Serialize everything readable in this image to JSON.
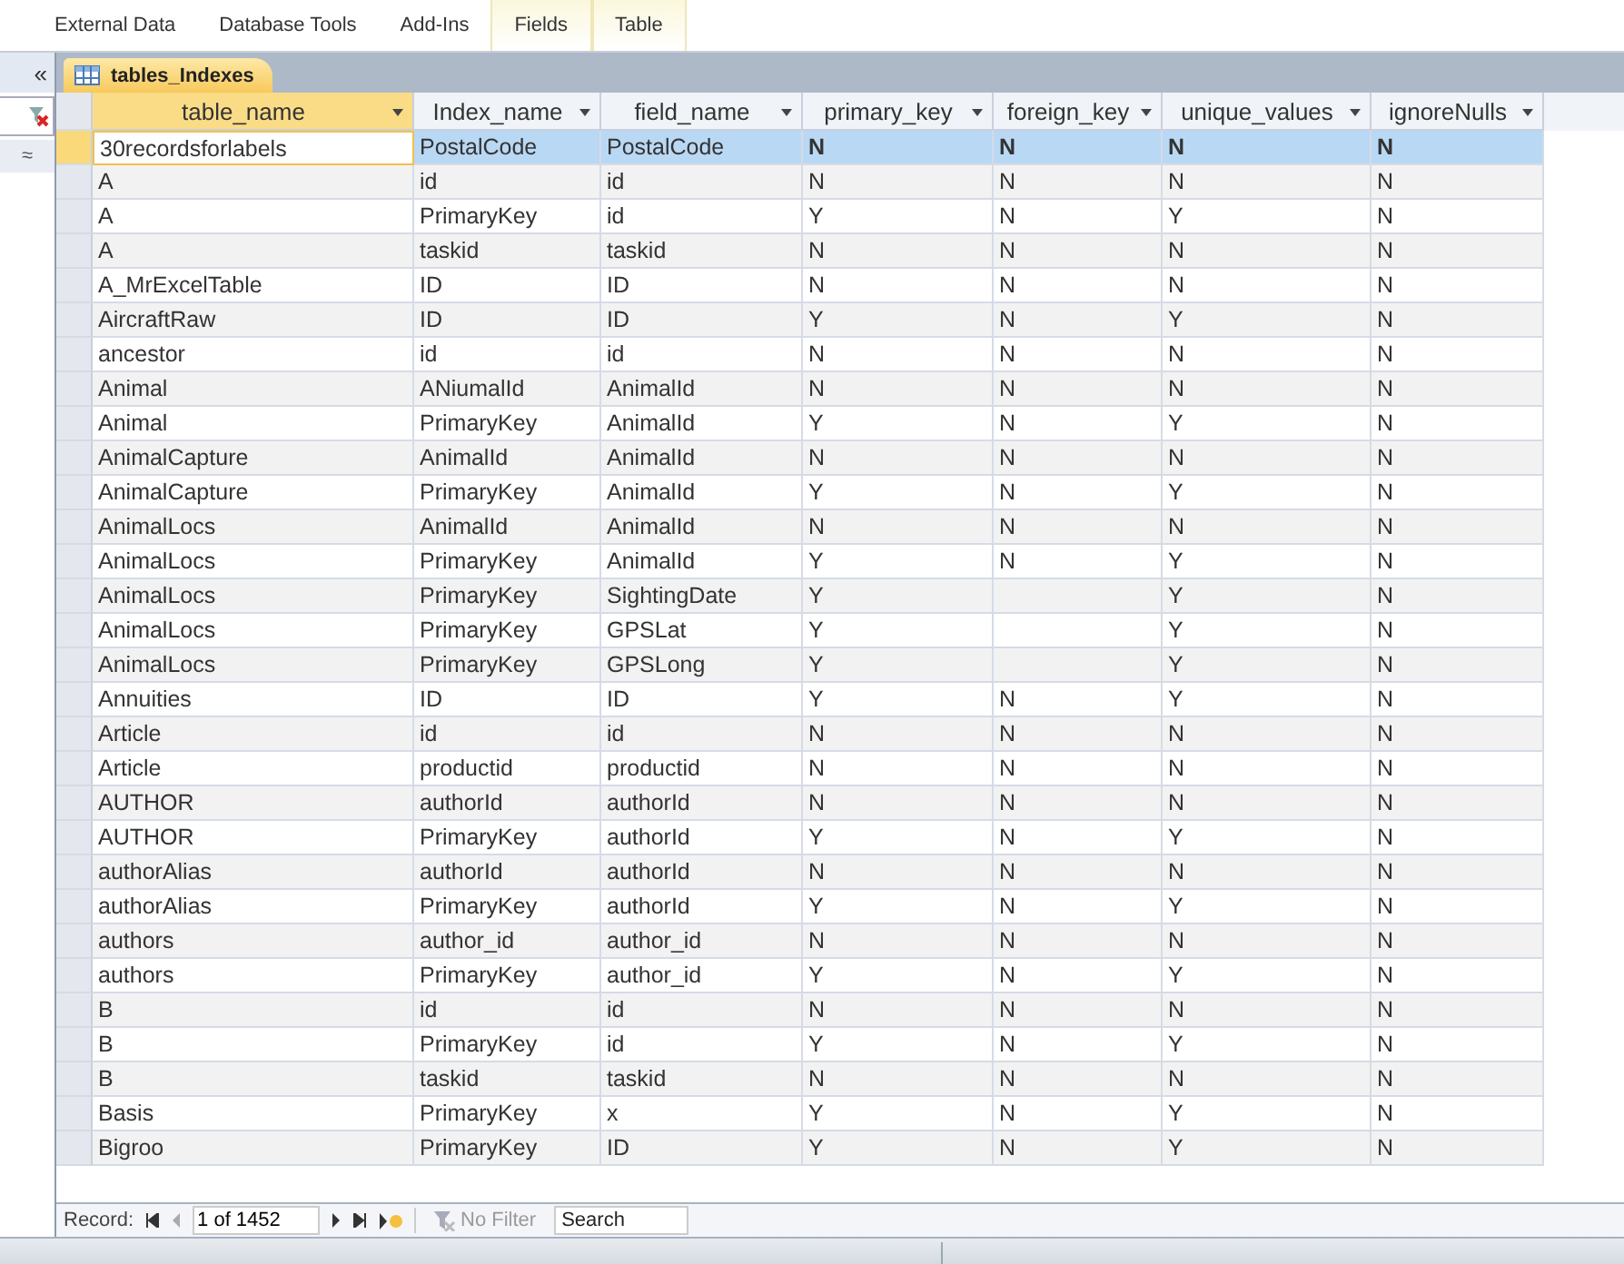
{
  "ribbon_tabs": [
    {
      "label": "External Data",
      "contextual": false
    },
    {
      "label": "Database Tools",
      "contextual": false
    },
    {
      "label": "Add-Ins",
      "contextual": false
    },
    {
      "label": "Fields",
      "contextual": true
    },
    {
      "label": "Table",
      "contextual": true
    }
  ],
  "nav_pane": {
    "collapse_glyph": "«",
    "expand_glyph": "≈"
  },
  "document_tab": {
    "title": "tables_Indexes"
  },
  "table": {
    "columns": [
      {
        "label": "table_name",
        "sorted": true
      },
      {
        "label": "Index_name",
        "sorted": false
      },
      {
        "label": "field_name",
        "sorted": false
      },
      {
        "label": "primary_key",
        "sorted": false
      },
      {
        "label": "foreign_key",
        "sorted": false
      },
      {
        "label": "unique_values",
        "sorted": false
      },
      {
        "label": "ignoreNulls",
        "sorted": false
      }
    ],
    "rows": [
      {
        "selected": true,
        "cells": [
          "30recordsforlabels",
          "PostalCode",
          "PostalCode",
          "N",
          "N",
          "N",
          "N"
        ]
      },
      {
        "selected": false,
        "cells": [
          "A",
          "id",
          "id",
          "N",
          "N",
          "N",
          "N"
        ]
      },
      {
        "selected": false,
        "cells": [
          "A",
          "PrimaryKey",
          "id",
          "Y",
          "N",
          "Y",
          "N"
        ]
      },
      {
        "selected": false,
        "cells": [
          "A",
          "taskid",
          "taskid",
          "N",
          "N",
          "N",
          "N"
        ]
      },
      {
        "selected": false,
        "cells": [
          "A_MrExcelTable",
          "ID",
          "ID",
          "N",
          "N",
          "N",
          "N"
        ]
      },
      {
        "selected": false,
        "cells": [
          "AircraftRaw",
          "ID",
          "ID",
          "Y",
          "N",
          "Y",
          "N"
        ]
      },
      {
        "selected": false,
        "cells": [
          "ancestor",
          "id",
          "id",
          "N",
          "N",
          "N",
          "N"
        ]
      },
      {
        "selected": false,
        "cells": [
          "Animal",
          "ANiumalId",
          "AnimalId",
          "N",
          "N",
          "N",
          "N"
        ]
      },
      {
        "selected": false,
        "cells": [
          "Animal",
          "PrimaryKey",
          "AnimalId",
          "Y",
          "N",
          "Y",
          "N"
        ]
      },
      {
        "selected": false,
        "cells": [
          "AnimalCapture",
          "AnimalId",
          "AnimalId",
          "N",
          "N",
          "N",
          "N"
        ]
      },
      {
        "selected": false,
        "cells": [
          "AnimalCapture",
          "PrimaryKey",
          "AnimalId",
          "Y",
          "N",
          "Y",
          "N"
        ]
      },
      {
        "selected": false,
        "cells": [
          "AnimalLocs",
          "AnimalId",
          "AnimalId",
          "N",
          "N",
          "N",
          "N"
        ]
      },
      {
        "selected": false,
        "cells": [
          "AnimalLocs",
          "PrimaryKey",
          "AnimalId",
          "Y",
          "N",
          "Y",
          "N"
        ]
      },
      {
        "selected": false,
        "cells": [
          "AnimalLocs",
          "PrimaryKey",
          "SightingDate",
          "Y",
          null,
          "Y",
          "N"
        ]
      },
      {
        "selected": false,
        "cells": [
          "AnimalLocs",
          "PrimaryKey",
          "GPSLat",
          "Y",
          null,
          "Y",
          "N"
        ]
      },
      {
        "selected": false,
        "cells": [
          "AnimalLocs",
          "PrimaryKey",
          "GPSLong",
          "Y",
          null,
          "Y",
          "N"
        ]
      },
      {
        "selected": false,
        "cells": [
          "Annuities",
          "ID",
          "ID",
          "Y",
          "N",
          "Y",
          "N"
        ]
      },
      {
        "selected": false,
        "cells": [
          "Article",
          "id",
          "id",
          "N",
          "N",
          "N",
          "N"
        ]
      },
      {
        "selected": false,
        "cells": [
          "Article",
          "productid",
          "productid",
          "N",
          "N",
          "N",
          "N"
        ]
      },
      {
        "selected": false,
        "cells": [
          "AUTHOR",
          "authorId",
          "authorId",
          "N",
          "N",
          "N",
          "N"
        ]
      },
      {
        "selected": false,
        "cells": [
          "AUTHOR",
          "PrimaryKey",
          "authorId",
          "Y",
          "N",
          "Y",
          "N"
        ]
      },
      {
        "selected": false,
        "cells": [
          "authorAlias",
          "authorId",
          "authorId",
          "N",
          "N",
          "N",
          "N"
        ]
      },
      {
        "selected": false,
        "cells": [
          "authorAlias",
          "PrimaryKey",
          "authorId",
          "Y",
          "N",
          "Y",
          "N"
        ]
      },
      {
        "selected": false,
        "cells": [
          "authors",
          "author_id",
          "author_id",
          "N",
          "N",
          "N",
          "N"
        ]
      },
      {
        "selected": false,
        "cells": [
          "authors",
          "PrimaryKey",
          "author_id",
          "Y",
          "N",
          "Y",
          "N"
        ]
      },
      {
        "selected": false,
        "cells": [
          "B",
          "id",
          "id",
          "N",
          "N",
          "N",
          "N"
        ]
      },
      {
        "selected": false,
        "cells": [
          "B",
          "PrimaryKey",
          "id",
          "Y",
          "N",
          "Y",
          "N"
        ]
      },
      {
        "selected": false,
        "cells": [
          "B",
          "taskid",
          "taskid",
          "N",
          "N",
          "N",
          "N"
        ]
      },
      {
        "selected": false,
        "cells": [
          "Basis",
          "PrimaryKey",
          "x",
          "Y",
          "N",
          "Y",
          "N"
        ]
      },
      {
        "selected": false,
        "cells": [
          "Bigroo",
          "PrimaryKey",
          "ID",
          "Y",
          "N",
          "Y",
          "N"
        ]
      }
    ]
  },
  "record_nav": {
    "label": "Record:",
    "position": "1 of 1452",
    "filter": "No Filter",
    "search_placeholder": "Search",
    "filtered": false
  }
}
